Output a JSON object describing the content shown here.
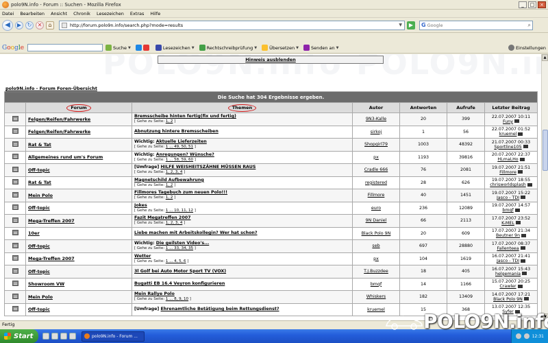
{
  "window": {
    "title": "polo9N.info - Forum :: Suchen - Mozilla Firefox"
  },
  "menu": [
    "Datei",
    "Bearbeiten",
    "Ansicht",
    "Chronik",
    "Lesezeichen",
    "Extras",
    "Hilfe"
  ],
  "nav": {
    "url": "http://forum.polo9n.info/search.php?mode=results",
    "search_placeholder": "Google"
  },
  "google_toolbar": {
    "logo": "Google",
    "search_label": "Suche",
    "bookmarks_label": "Lesezeichen",
    "spellcheck_label": "Rechtschreibprüfung",
    "translate_label": "Übersetzen",
    "send_label": "Senden an",
    "settings_label": "Einstellungen"
  },
  "page": {
    "notice_link": "Hinweis ausblenden",
    "breadcrumb": "polo9N.info - Forum Foren-Übersicht",
    "results_caption": "Die Suche hat 304 Ergebnisse ergeben.",
    "watermark": "POLO9N.info",
    "columns": {
      "forum": "Forum",
      "topics": "Themen",
      "author": "Autor",
      "replies": "Antworten",
      "views": "Aufrufe",
      "last_post": "Letzter Beitrag"
    },
    "goto_prefix": "[ Gehe zu Seite: ",
    "goto_suffix": " ]",
    "rows": [
      {
        "forum": "Felgen/Reifen/Fahrwerke",
        "prefix": "",
        "topic": "Bremsscheibe hinten fertig(fix und fertig)",
        "pages": "1, 2",
        "author": "9N3-Kalle",
        "replies": "20",
        "views": "399",
        "last_date": "22.07.2007 10:11",
        "last_user": "Funy"
      },
      {
        "forum": "Felgen/Reifen/Fahrwerke",
        "prefix": "",
        "topic": "Abnutzung hintere Bremsscheiben",
        "pages": "",
        "author": "sirkoj",
        "replies": "1",
        "views": "56",
        "last_date": "22.07.2007 01:52",
        "last_user": "kruemel"
      },
      {
        "forum": "Rat & Tat",
        "prefix": "Wichtig: ",
        "topic": "Aktuelle Lieferzeiten",
        "pages": "1 ... 49, 50, 51",
        "author": "Shopgirl79",
        "replies": "1003",
        "views": "48392",
        "last_date": "21.07.2007 00:33",
        "last_user": "Sportline105"
      },
      {
        "forum": "Allgemeines rund um's Forum",
        "prefix": "Wichtig: ",
        "topic": "Anregungen? Wünsche?",
        "pages": "1 ... 58, 59, 60",
        "author": "px",
        "replies": "1193",
        "views": "39816",
        "last_date": "20.07.2007 22:37",
        "last_user": "HLmaLHo"
      },
      {
        "forum": "Off-topic",
        "prefix": "[Umfrage] ",
        "topic": "HILFE WEISHEITSZÄHNE MÜSSEN RAUS",
        "pages": "1, 2, 3, 4",
        "author": "Cradle 666",
        "replies": "76",
        "views": "2081",
        "last_date": "19.07.2007 21:51",
        "last_user": "Fillmore"
      },
      {
        "forum": "Rat & Tat",
        "prefix": "",
        "topic": "Magnetschild Aufbewahrung",
        "pages": "1, 2",
        "author": "registered",
        "replies": "28",
        "views": "626",
        "last_date": "19.07.2007 18:55",
        "last_user": "chrisworldsplash"
      },
      {
        "forum": "Mein Polo",
        "prefix": "",
        "topic": "Fillmores Tagebuch zum neuen Polo!!!",
        "pages": "1, 2",
        "author": "Fillmore",
        "replies": "40",
        "views": "1451",
        "last_date": "19.07.2007 15:22",
        "last_user": "Jasco - TDI"
      },
      {
        "forum": "Off-topic",
        "prefix": "",
        "topic": "Jokes",
        "pages": "1 ... 10, 11, 12",
        "author": "euro",
        "replies": "236",
        "views": "12089",
        "last_date": "19.07.2007 14:57",
        "last_user": "bmqf"
      },
      {
        "forum": "Mega-Treffen 2007",
        "prefix": "",
        "topic": "Fazit Megatreffen 2007",
        "pages": "1, 2, 3, 4",
        "author": "9N Daniel",
        "replies": "66",
        "views": "2113",
        "last_date": "17.07.2007 23:52",
        "last_user": "K-MEL"
      },
      {
        "forum": "10er",
        "prefix": "",
        "topic": "Liebe machen mit Arbeitskollegin? Wer hat schon?",
        "pages": "",
        "author": "Black Polo 9N",
        "replies": "20",
        "views": "609",
        "last_date": "17.07.2007 21:34",
        "last_user": "Beutner 9n"
      },
      {
        "forum": "Off-topic",
        "prefix": "Wichtig: ",
        "topic": "Die geilsten Video's...",
        "pages": "1 ... 33, 34, 35",
        "author": "seb",
        "replies": "697",
        "views": "28880",
        "last_date": "17.07.2007 08:37",
        "last_user": "Fallenteea"
      },
      {
        "forum": "Mega-Treffen 2007",
        "prefix": "",
        "topic": "Wetter",
        "pages": "1 ... 4, 5, 6",
        "author": "px",
        "replies": "104",
        "views": "1619",
        "last_date": "16.07.2007 21:41",
        "last_user": "Jasco - TDI"
      },
      {
        "forum": "Off-topic",
        "prefix": "",
        "topic": "3l Golf bei Auto Motor Sport TV (VOX)",
        "pages": "",
        "author": "T.J.Buzzdee",
        "replies": "18",
        "views": "405",
        "last_date": "16.07.2007 15:43",
        "last_user": "helgemania"
      },
      {
        "forum": "Showroom VW",
        "prefix": "",
        "topic": "Bugatti EB 16.4 Veyron konfigurieren",
        "pages": "",
        "author": "bmqf",
        "replies": "14",
        "views": "1166",
        "last_date": "15.07.2007 20:25",
        "last_user": "Crawler"
      },
      {
        "forum": "Mein Polo",
        "prefix": "",
        "topic": "Mein Rallye Polo",
        "pages": "1 ... 8, 9, 10",
        "author": "Whiskers",
        "replies": "182",
        "views": "13409",
        "last_date": "14.07.2007 17:21",
        "last_user": "Black Polo 9N"
      },
      {
        "forum": "Off-topic",
        "prefix": "[Umfrage] ",
        "topic": "Ehrenamtliche Betätigung beim Rettungsdienst?",
        "pages": "",
        "author": "kruemel",
        "replies": "15",
        "views": "368",
        "last_date": "13.07.2007 12:35",
        "last_user": "Syfer"
      }
    ]
  },
  "status": {
    "text": "Fertig"
  },
  "taskbar": {
    "start_label": "Start",
    "task_label": "polo9N.info - Forum ...",
    "clock": "12:31"
  },
  "brand": {
    "text": "POLO9N.info"
  }
}
